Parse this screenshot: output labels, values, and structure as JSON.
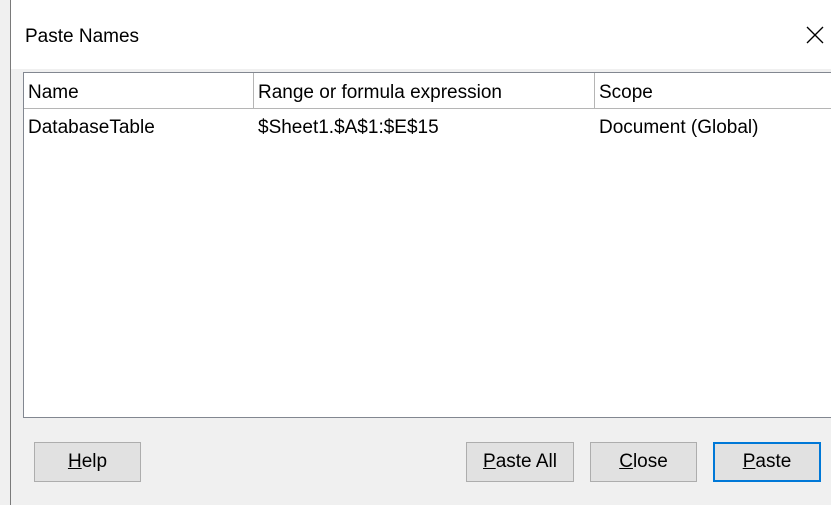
{
  "dialog": {
    "title": "Paste Names",
    "close_icon": "close-icon"
  },
  "table": {
    "columns": [
      "Name",
      "Range or formula expression",
      "Scope"
    ],
    "rows": [
      [
        "DatabaseTable",
        "$Sheet1.$A$1:$E$15",
        "Document (Global)"
      ]
    ]
  },
  "buttons": {
    "help": {
      "mnemonic": "H",
      "rest": "elp"
    },
    "paste_all": {
      "mnemonic": "P",
      "rest": "aste All"
    },
    "close": {
      "mnemonic": "C",
      "rest": "lose"
    },
    "paste": {
      "mnemonic": "P",
      "rest": "aste"
    }
  },
  "colors": {
    "default_button_border": "#0078d7",
    "button_face": "#e1e1e1",
    "dialog_background": "#f0f0f0"
  }
}
